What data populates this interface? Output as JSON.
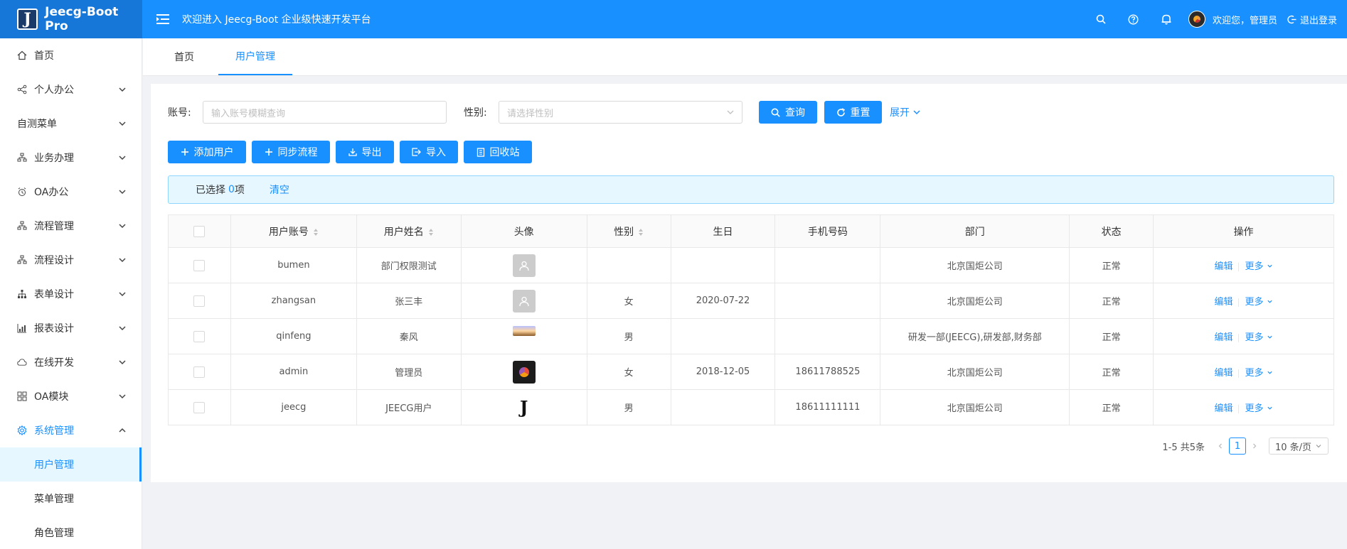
{
  "app": {
    "title": "Jeecg-Boot Pro",
    "logo_letter": "J",
    "welcome": "欢迎进入 Jeecg-Boot 企业级快速开发平台"
  },
  "header": {
    "user_text": "欢迎您，管理员",
    "logout_label": "退出登录"
  },
  "sidebar": {
    "items": [
      {
        "label": "首页",
        "icon": "home-icon",
        "expandable": false
      },
      {
        "label": "个人办公",
        "icon": "share-icon",
        "expandable": true
      },
      {
        "label": "自测菜单",
        "icon": "",
        "expandable": true
      },
      {
        "label": "业务办理",
        "icon": "cluster-icon",
        "expandable": true
      },
      {
        "label": "OA办公",
        "icon": "alarm-icon",
        "expandable": true
      },
      {
        "label": "流程管理",
        "icon": "cluster-icon",
        "expandable": true
      },
      {
        "label": "流程设计",
        "icon": "cluster-icon",
        "expandable": true
      },
      {
        "label": "表单设计",
        "icon": "apartment-icon",
        "expandable": true
      },
      {
        "label": "报表设计",
        "icon": "chart-icon",
        "expandable": true
      },
      {
        "label": "在线开发",
        "icon": "cloud-icon",
        "expandable": true
      },
      {
        "label": "OA模块",
        "icon": "grid-icon",
        "expandable": true
      },
      {
        "label": "系统管理",
        "icon": "gear-icon",
        "expandable": true,
        "open": true
      }
    ],
    "sub_items": [
      "用户管理",
      "菜单管理",
      "角色管理"
    ]
  },
  "tabs": [
    {
      "label": "首页"
    },
    {
      "label": "用户管理",
      "active": true
    }
  ],
  "search": {
    "account_label": "账号:",
    "account_placeholder": "输入账号模糊查询",
    "gender_label": "性别:",
    "gender_placeholder": "请选择性别",
    "query_label": "查询",
    "reset_label": "重置",
    "expand_label": "展开"
  },
  "toolbar": {
    "add_user": "添加用户",
    "sync_flow": "同步流程",
    "export": "导出",
    "import": "导入",
    "recycle": "回收站"
  },
  "selection": {
    "prefix": "已选择",
    "count": "0",
    "suffix": "项",
    "clear": "清空"
  },
  "table": {
    "columns": [
      "用户账号",
      "用户姓名",
      "头像",
      "性别",
      "生日",
      "手机号码",
      "部门",
      "状态",
      "操作"
    ],
    "rows": [
      {
        "account": "bumen",
        "name": "部门权限测试",
        "avatar": "default",
        "gender": "",
        "birthday": "",
        "phone": "",
        "dept": "北京国炬公司",
        "status": "正常"
      },
      {
        "account": "zhangsan",
        "name": "张三丰",
        "avatar": "default",
        "gender": "女",
        "birthday": "2020-07-22",
        "phone": "",
        "dept": "北京国炬公司",
        "status": "正常"
      },
      {
        "account": "qinfeng",
        "name": "秦风",
        "avatar": "photo",
        "gender": "男",
        "birthday": "",
        "phone": "",
        "dept": "研发一部(JEECG),研发部,财务部",
        "status": "正常"
      },
      {
        "account": "admin",
        "name": "管理员",
        "avatar": "logo",
        "gender": "女",
        "birthday": "2018-12-05",
        "phone": "18611788525",
        "dept": "北京国炬公司",
        "status": "正常"
      },
      {
        "account": "jeecg",
        "name": "JEECG用户",
        "avatar": "j",
        "gender": "男",
        "birthday": "",
        "phone": "18611111111",
        "dept": "北京国炬公司",
        "status": "正常"
      }
    ],
    "edit_label": "编辑",
    "more_label": "更多"
  },
  "pagination": {
    "summary": "1-5 共5条",
    "current": "1",
    "page_size": "10 条/页"
  },
  "colors": {
    "primary": "#1890ff",
    "header_bg": "#1890ff",
    "alert_bg": "#e6f7ff"
  }
}
